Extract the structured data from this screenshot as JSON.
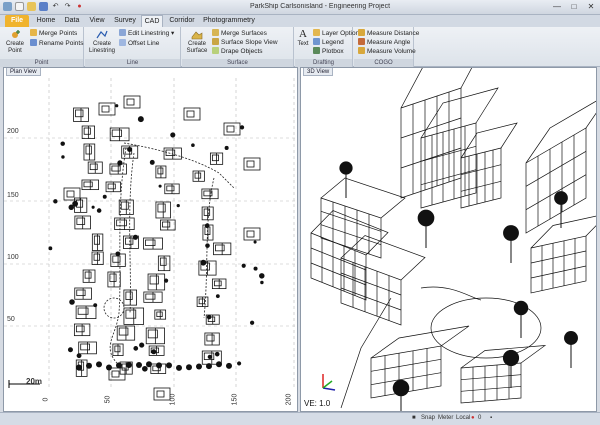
{
  "window": {
    "title": "ParkShip Carlsonisland - Engineering Project",
    "controls": [
      "—",
      "□",
      "✕"
    ]
  },
  "tabs": [
    "File",
    "Home",
    "Data",
    "View",
    "Survey",
    "CAD",
    "Corridor",
    "Photogrammetry"
  ],
  "active_tab": "CAD",
  "ribbon": {
    "point": {
      "label": "Point",
      "create": "Create Point",
      "merge": "Merge Points",
      "rename": "Rename Points"
    },
    "line": {
      "label": "Line",
      "create": "Create Linestring",
      "edit": "Edit Linestring",
      "offset": "Offset Line"
    },
    "surface": {
      "label": "Surface",
      "create": "Create Surface",
      "merge": "Merge Surfaces",
      "slope": "Surface Slope View",
      "drape": "Drape Objects"
    },
    "drafting": {
      "label": "Drafting",
      "text": "Text",
      "layer": "Layer Options",
      "legend": "Legend",
      "plotbox": "Plotbox"
    },
    "cogo": {
      "label": "COGO",
      "distance": "Measure Distance",
      "angle": "Measure Angle",
      "volume": "Measure Volume"
    }
  },
  "plan_view": {
    "tab": "Plan View",
    "y_ticks": [
      "200",
      "150",
      "100",
      "50"
    ],
    "x_ticks": [
      "0",
      "50",
      "100",
      "150",
      "200"
    ],
    "scale_label": "20m"
  },
  "view_3d": {
    "tab": "3D View",
    "ve_label": "VE: 1.0"
  },
  "status": {
    "snap": "Snap",
    "meter": "Meter",
    "local": "Local",
    "value": "0"
  },
  "colors": {
    "file_tab": "#f0b32d",
    "ribbon_bg": "#eef1f5",
    "canvas": "#ffffff"
  }
}
